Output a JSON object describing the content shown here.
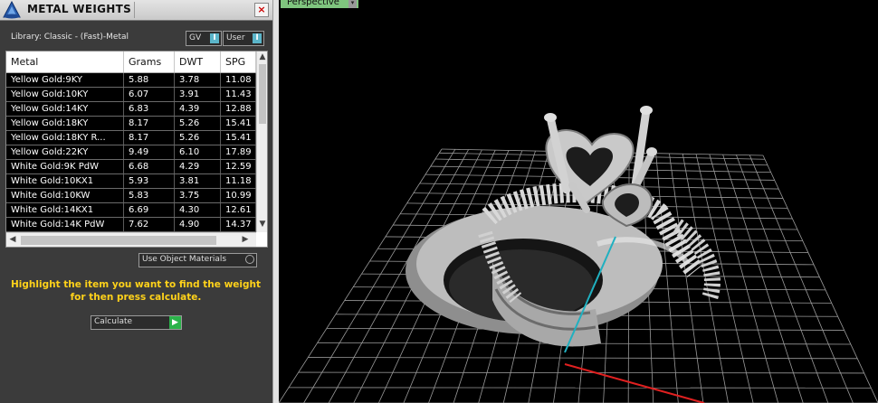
{
  "window": {
    "title": "METAL WEIGHTS",
    "close_glyph": "×",
    "logo_icon": "app-logo-icon"
  },
  "library": {
    "label": "Library: Classic - (Fast)-Metal",
    "gv_label": "GV",
    "user_label": "User",
    "dropdown_icon": "dropdown-arrow-icon"
  },
  "table": {
    "columns": [
      "Metal",
      "Grams",
      "DWT",
      "SPG"
    ],
    "rows": [
      [
        "Yellow Gold:9KY",
        "5.88",
        "3.78",
        "11.08"
      ],
      [
        "Yellow Gold:10KY",
        "6.07",
        "3.91",
        "11.43"
      ],
      [
        "Yellow Gold:14KY",
        "6.83",
        "4.39",
        "12.88"
      ],
      [
        "Yellow Gold:18KY",
        "8.17",
        "5.26",
        "15.41"
      ],
      [
        "Yellow Gold:18KY R...",
        "8.17",
        "5.26",
        "15.41"
      ],
      [
        "Yellow Gold:22KY",
        "9.49",
        "6.10",
        "17.89"
      ],
      [
        "White Gold:9K PdW",
        "6.68",
        "4.29",
        "12.59"
      ],
      [
        "White Gold:10KX1",
        "5.93",
        "3.81",
        "11.18"
      ],
      [
        "White Gold:10KW",
        "5.83",
        "3.75",
        "10.99"
      ],
      [
        "White Gold:14KX1",
        "6.69",
        "4.30",
        "12.61"
      ],
      [
        "White Gold:14K PdW",
        "7.62",
        "4.90",
        "14.37"
      ]
    ],
    "scroll": {
      "up": "▲",
      "down": "▼",
      "left": "◀",
      "right": "▶"
    }
  },
  "options": {
    "use_object_materials_label": "Use Object Materials"
  },
  "hint": {
    "line1": "Highlight the item you want to find the weight",
    "line2": "for then press calculate."
  },
  "calculate": {
    "label": "Calculate",
    "go_glyph": "▶"
  },
  "viewport": {
    "label": "Perspective",
    "dropdown_glyph": "▾"
  },
  "colors": {
    "panel_bg": "#3b3b3b",
    "hint_text": "#ffd21a",
    "selected_row_bg": "#000000",
    "accent_blue": "#5bb5c9",
    "go_green": "#2bb34a",
    "viewport_label_bg": "#7fc57e",
    "grid": "#9a9a9a",
    "axis_x": "#e02020",
    "axis_y": "#20b0c0"
  }
}
